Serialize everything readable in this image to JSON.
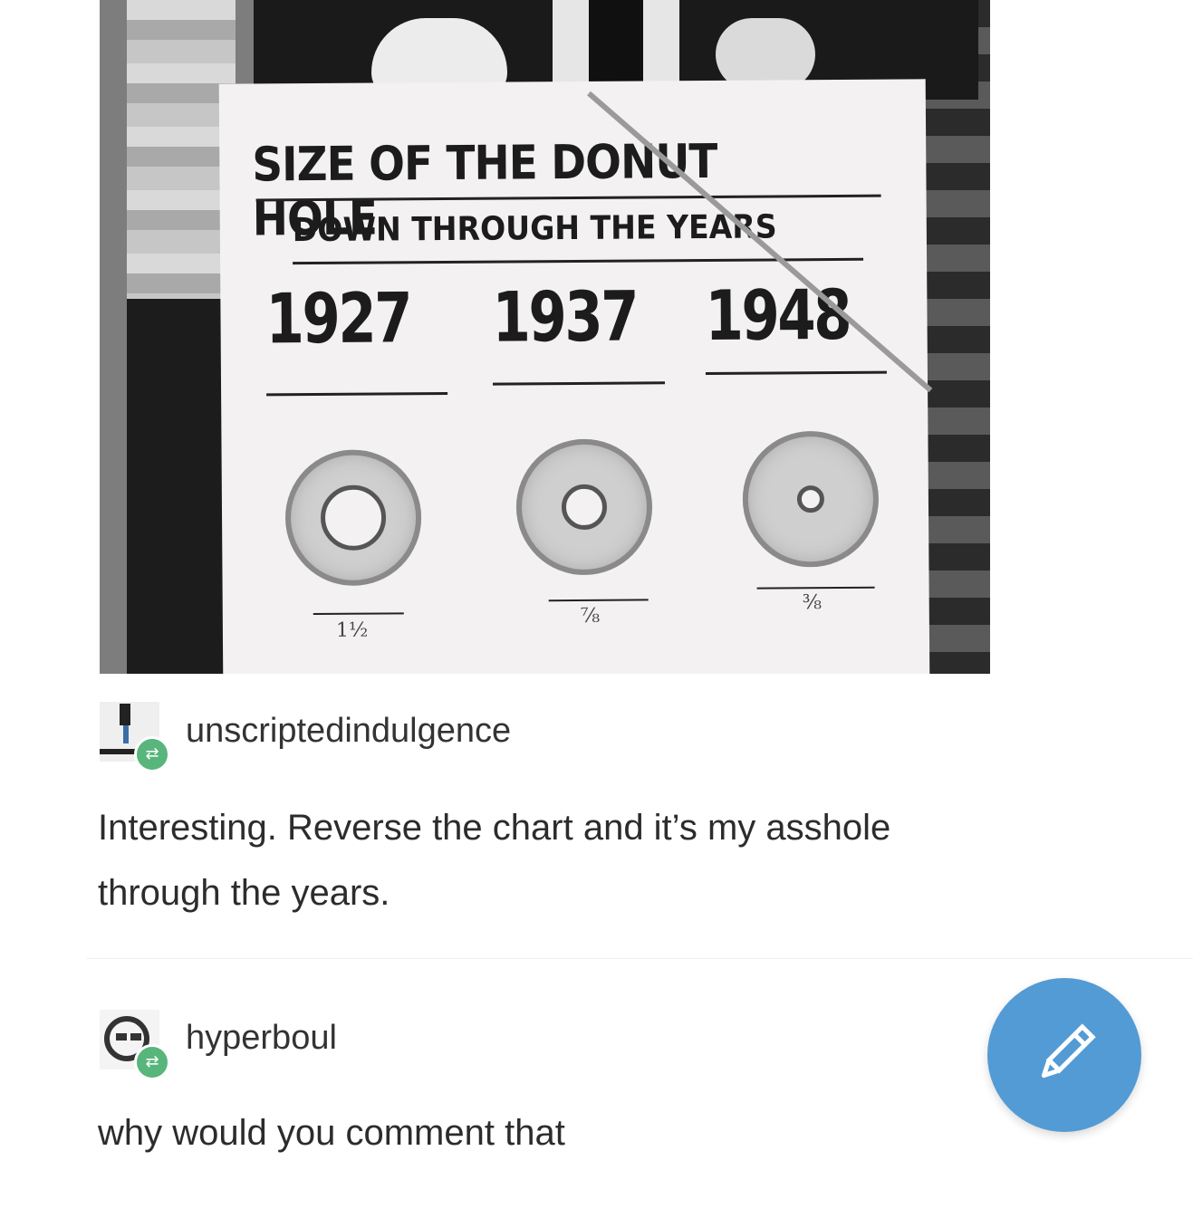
{
  "image": {
    "poster_title": "SIZE OF THE DONUT HOLE",
    "poster_subtitle": "DOWN THROUGH THE YEARS",
    "years": [
      "1927",
      "1937",
      "1948"
    ],
    "hole_sizes": [
      "1½",
      "⅞",
      "⅜"
    ]
  },
  "posts": [
    {
      "username": "unscriptedindulgence",
      "comment_line1": "Interesting. Reverse the chart and it’s my asshole",
      "comment_line2": "through the years."
    },
    {
      "username": "hyperboul",
      "comment_line1": "why would you comment that"
    }
  ],
  "icons": {
    "reblog_badge": "reblog-icon",
    "compose_button": "pencil-icon"
  },
  "colors": {
    "reblog_badge": "#58b57c",
    "compose_button": "#539bd5"
  }
}
